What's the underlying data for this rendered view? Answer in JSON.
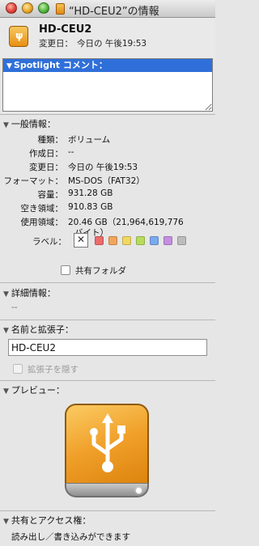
{
  "window": {
    "title": "“HD-CEU2”の情報"
  },
  "header": {
    "name": "HD-CEU2",
    "modified_label": "変更日：",
    "modified_value": "今日の 午後19:53"
  },
  "spotlight": {
    "heading": "Spotlight コメント：",
    "comment": ""
  },
  "general": {
    "heading": "一般情報：",
    "rows": [
      {
        "label": "種類：",
        "value": "ボリューム"
      },
      {
        "label": "作成日：",
        "value": "--"
      },
      {
        "label": "変更日：",
        "value": "今日の 午後19:53"
      },
      {
        "label": "フォーマット：",
        "value": "MS-DOS（FAT32）"
      },
      {
        "label": "容量：",
        "value": "931.28 GB"
      },
      {
        "label": "空き領域：",
        "value": "910.83 GB"
      },
      {
        "label": "使用領域：",
        "value": "20.46 GB（21,964,619,776"
      }
    ],
    "used_line2": "バイト）",
    "label_caption": "ラベル：",
    "label_none": "✕",
    "label_colors": [
      "#ec6b6b",
      "#f2a55a",
      "#f0d860",
      "#b7dc5b",
      "#79a9ee",
      "#c58ee0",
      "#bcbcbc"
    ],
    "shared_folder_label": "共有フォルダ",
    "shared_folder_checked": false
  },
  "more_info": {
    "heading": "詳細情報：",
    "value": "--"
  },
  "name_ext": {
    "heading": "名前と拡張子：",
    "name_value": "HD-CEU2",
    "hide_ext_label": "拡張子を隠す",
    "hide_ext_checked": false
  },
  "preview": {
    "heading": "プレビュー：",
    "icon": "usb-drive-icon"
  },
  "sharing": {
    "heading": "共有とアクセス権：",
    "value": "読み出し／書き込みができます"
  },
  "colors": {
    "spotlight_header": "#2f6fd9",
    "drive_orange": "#f0a02a"
  }
}
